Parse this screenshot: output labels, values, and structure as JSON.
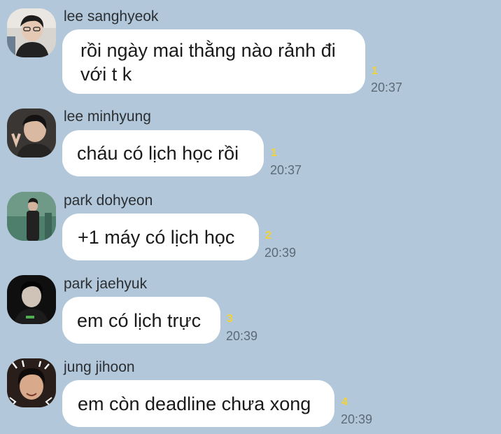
{
  "messages": [
    {
      "sender": "lee sanghyeok",
      "text": "rồi ngày mai thằng nào rảnh đi với t k",
      "unread": "1",
      "time": "20:37"
    },
    {
      "sender": "lee minhyung",
      "text": "cháu có lịch học rồi",
      "unread": "1",
      "time": "20:37"
    },
    {
      "sender": "park dohyeon",
      "text": "+1 máy có lịch học",
      "unread": "2",
      "time": "20:39"
    },
    {
      "sender": "park jaehyuk",
      "text": "em có lịch trực",
      "unread": "3",
      "time": "20:39"
    },
    {
      "sender": "jung jihoon",
      "text": "em còn deadline chưa xong",
      "unread": "4",
      "time": "20:39"
    }
  ],
  "colors": {
    "background": "#b2c7d9",
    "bubble": "#ffffff",
    "unread": "#f2d333",
    "time": "#5b6a78"
  },
  "icons": [
    "avatar-photo"
  ]
}
